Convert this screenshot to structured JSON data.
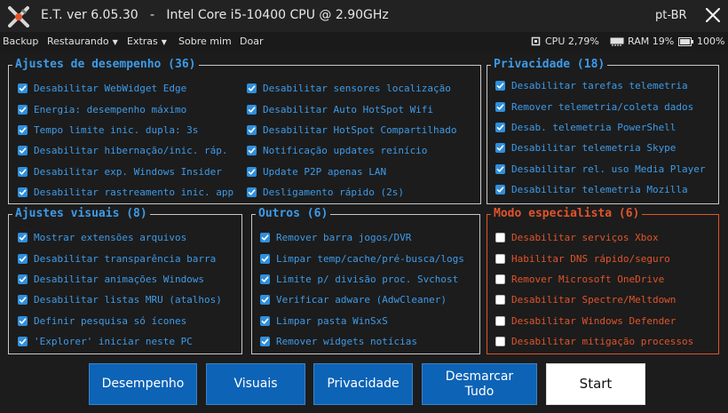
{
  "window": {
    "title": "E.T. ver 6.05.30   -   Intel Core i5-10400 CPU @ 2.90GHz",
    "language": "pt-BR"
  },
  "menu": {
    "items": [
      "Backup",
      "Restaurando",
      "Extras",
      "Sobre mim",
      "Doar"
    ]
  },
  "status": {
    "cpu": "CPU 2,79%",
    "ram": "RAM 19%",
    "battery": "100%"
  },
  "groups": {
    "desempenho": {
      "title": "Ajustes de desempenho (36)",
      "col1": [
        {
          "label": "Desabilitar WebWidget Edge",
          "checked": true
        },
        {
          "label": "Energia: desempenho máximo",
          "checked": true
        },
        {
          "label": "Tempo limite inic. dupla: 3s",
          "checked": true
        },
        {
          "label": "Desabilitar hibernação/inic. ráp.",
          "checked": true
        },
        {
          "label": "Desabilitar exp. Windows Insider",
          "checked": true
        },
        {
          "label": "Desabilitar rastreamento inic. app",
          "checked": true
        }
      ],
      "col2": [
        {
          "label": "Desabilitar sensores localização",
          "checked": true
        },
        {
          "label": "Desabilitar Auto HotSpot Wifi",
          "checked": true
        },
        {
          "label": "Desabilitar HotSpot Compartilhado",
          "checked": true
        },
        {
          "label": "Notificação updates reinício",
          "checked": true
        },
        {
          "label": "Update P2P apenas LAN",
          "checked": true
        },
        {
          "label": "Desligamento rápido (2s)",
          "checked": true
        }
      ]
    },
    "privacidade": {
      "title": "Privacidade (18)",
      "items": [
        {
          "label": "Desabilitar tarefas telemetria",
          "checked": true
        },
        {
          "label": "Remover telemetria/coleta dados",
          "checked": true
        },
        {
          "label": "Desab. telemetria PowerShell",
          "checked": true
        },
        {
          "label": "Desabilitar telemetria Skype",
          "checked": true
        },
        {
          "label": "Desabilitar rel. uso Media Player",
          "checked": true
        },
        {
          "label": "Desabilitar telemetria Mozilla",
          "checked": true
        }
      ]
    },
    "visuais": {
      "title": "Ajustes visuais (8)",
      "items": [
        {
          "label": "Mostrar extensões arquivos",
          "checked": true
        },
        {
          "label": "Desabilitar transparência barra",
          "checked": true
        },
        {
          "label": "Desabilitar animações Windows",
          "checked": true
        },
        {
          "label": "Desabilitar listas MRU (atalhos)",
          "checked": true
        },
        {
          "label": "Definir pesquisa só ícones",
          "checked": true
        },
        {
          "label": "'Explorer' iniciar neste PC",
          "checked": true
        }
      ]
    },
    "outros": {
      "title": "Outros (6)",
      "items": [
        {
          "label": "Remover barra jogos/DVR",
          "checked": true
        },
        {
          "label": "Limpar temp/cache/pré-busca/logs",
          "checked": true
        },
        {
          "label": "Limite p/ divisão proc. Svchost",
          "checked": true
        },
        {
          "label": "Verificar adware (AdwCleaner)",
          "checked": true
        },
        {
          "label": "Limpar pasta WinSxS",
          "checked": true
        },
        {
          "label": "Remover widgets notícias",
          "checked": true
        }
      ]
    },
    "especialista": {
      "title": "Modo especialista (6)",
      "items": [
        {
          "label": "Desabilitar serviços Xbox",
          "checked": false
        },
        {
          "label": "Habilitar DNS rápido/seguro",
          "checked": false
        },
        {
          "label": "Remover Microsoft OneDrive",
          "checked": false
        },
        {
          "label": "Desabilitar Spectre/Meltdown",
          "checked": false
        },
        {
          "label": "Desabilitar Windows Defender",
          "checked": false
        },
        {
          "label": "Desabilitar mitigação processos",
          "checked": false
        }
      ]
    }
  },
  "buttons": {
    "desempenho": "Desempenho",
    "visuais": "Visuais",
    "privacidade": "Privacidade",
    "desmarcar_line1": "Desmarcar",
    "desmarcar_line2": "Tudo",
    "start": "Start"
  },
  "colors": {
    "accent_blue": "#3d9be9",
    "expert_orange": "#e0542a",
    "button_blue": "#0d63b6",
    "background": "#1c1c1c"
  }
}
